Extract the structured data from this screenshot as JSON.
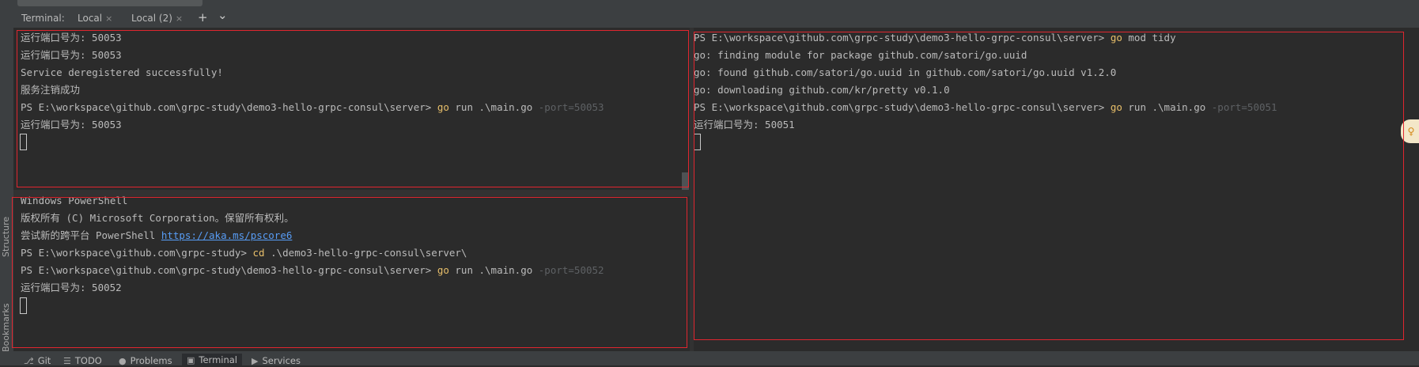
{
  "tabbar": {
    "title": "Terminal:",
    "tabs": [
      {
        "label": "Local",
        "close": "×"
      },
      {
        "label": "Local (2)",
        "close": "×"
      }
    ],
    "add_icon": "+",
    "dropdown_icon": "⌄"
  },
  "sidebar": {
    "structure_label": "Structure",
    "bookmarks_label": "Bookmarks"
  },
  "pane_top_left": {
    "lines": [
      "运行端口号为: 50053",
      "运行端口号为: 50053",
      "Service deregistered successfully!",
      "服务注销成功"
    ],
    "prompt": "PS E:\\workspace\\github.com\\grpc-study\\demo3-hello-grpc-consul\\server>",
    "cmd": "go",
    "args": "run .\\main.go",
    "flag": "-port=50053",
    "after": "运行端口号为: 50053"
  },
  "pane_bottom_left": {
    "line1": "Windows PowerShell",
    "line2": "版权所有 (C) Microsoft Corporation。保留所有权利。",
    "line3_text": "尝试新的跨平台 PowerShell ",
    "line3_link": "https://aka.ms/pscore6",
    "prompt1": "PS E:\\workspace\\github.com\\grpc-study>",
    "cmd1": "cd",
    "args1": ".\\demo3-hello-grpc-consul\\server\\",
    "prompt2": "PS E:\\workspace\\github.com\\grpc-study\\demo3-hello-grpc-consul\\server>",
    "cmd2": "go",
    "args2": "run .\\main.go",
    "flag2": "-port=50052",
    "after": "运行端口号为: 50052"
  },
  "pane_right": {
    "prompt1": "PS E:\\workspace\\github.com\\grpc-study\\demo3-hello-grpc-consul\\server>",
    "cmd1": "go",
    "args1": "mod tidy",
    "out1": "go: finding module for package github.com/satori/go.uuid",
    "out2": "go: found github.com/satori/go.uuid in github.com/satori/go.uuid v1.2.0",
    "out3": "go: downloading github.com/kr/pretty v0.1.0",
    "prompt2": "PS E:\\workspace\\github.com\\grpc-study\\demo3-hello-grpc-consul\\server>",
    "cmd2": "go",
    "args2": "run .\\main.go",
    "flag2": "-port=50051",
    "after": "运行端口号为: 50051"
  },
  "bottombar": {
    "items": [
      {
        "icon": "git-icon",
        "label": "Git"
      },
      {
        "icon": "todo-icon",
        "label": "TODO"
      },
      {
        "icon": "problems-icon",
        "label": "Problems"
      },
      {
        "icon": "terminal-icon",
        "label": "Terminal"
      },
      {
        "icon": "services-icon",
        "label": "Services"
      }
    ]
  },
  "colors": {
    "background": "#2b2b2b",
    "keyword": "#e8bf6a",
    "highlight_border": "#e0262f",
    "link": "#589df6"
  }
}
